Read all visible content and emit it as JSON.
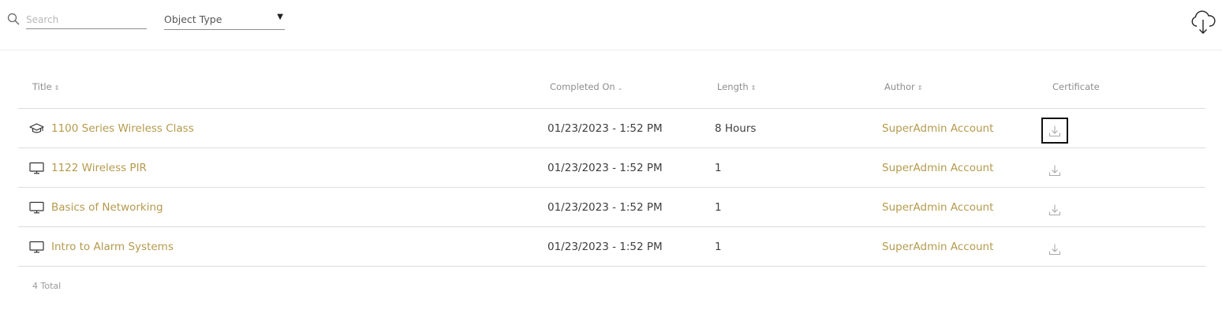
{
  "toolbar": {
    "search_placeholder": "Search",
    "search_value": "",
    "object_type_label": "Object Type",
    "object_type_caret": "▼",
    "download_all_icon": "cloud-download-icon"
  },
  "table": {
    "headers": {
      "title": "Title",
      "completed_on": "Completed On",
      "length": "Length",
      "author": "Author",
      "certificate": "Certificate"
    },
    "sort_glyphs": {
      "both": "⇕",
      "desc": "⌄"
    },
    "rows": [
      {
        "type_icon": "graduation-cap-icon",
        "title": "1100 Series Wireless Class",
        "completed_on": "01/23/2023 - 1:52 PM",
        "length": "8 Hours",
        "author": "SuperAdmin Account",
        "cert_icon": "download-icon"
      },
      {
        "type_icon": "monitor-icon",
        "title": "1122 Wireless PIR",
        "completed_on": "01/23/2023 - 1:52 PM",
        "length": "1",
        "author": "SuperAdmin Account",
        "cert_icon": "download-icon"
      },
      {
        "type_icon": "monitor-icon",
        "title": "Basics of Networking",
        "completed_on": "01/23/2023 - 1:52 PM",
        "length": "1",
        "author": "SuperAdmin Account",
        "cert_icon": "download-icon"
      },
      {
        "type_icon": "monitor-icon",
        "title": "Intro to Alarm Systems",
        "completed_on": "01/23/2023 - 1:52 PM",
        "length": "1",
        "author": "SuperAdmin Account",
        "cert_icon": "download-icon"
      }
    ],
    "total": "4 Total"
  },
  "colors": {
    "link": "#b59a4d",
    "header_text": "#8e8e8e",
    "divider": "#dcdcdc"
  }
}
